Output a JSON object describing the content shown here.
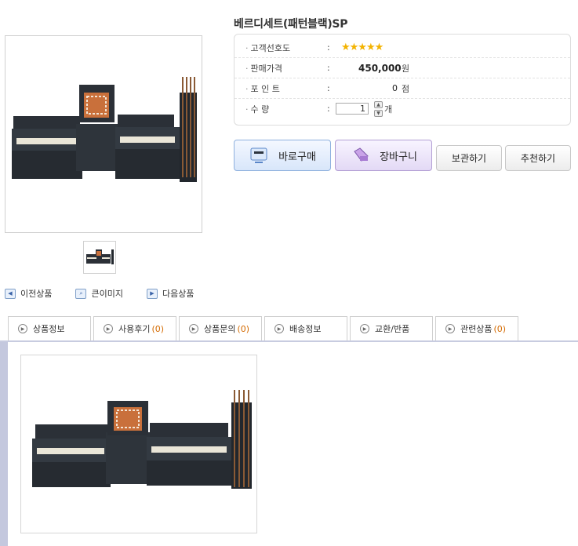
{
  "product": {
    "title": "베르디세트(패턴블랙)SP",
    "rating_label": "고객선호도",
    "rating_stars": 5,
    "rating_display": "★★★★★",
    "price_label": "판매가격",
    "price_value": "450,000",
    "price_unit": "원",
    "point_label": "포 인 트",
    "point_value": "0",
    "point_unit": "점",
    "qty_label": "수 량",
    "qty_value": "1",
    "qty_unit": "개",
    "colon": ":"
  },
  "buttons": {
    "buy": "바로구매",
    "cart": "장바구니",
    "keep": "보관하기",
    "recommend": "추천하기"
  },
  "nav": {
    "prev": "이전상품",
    "zoom": "큰이미지",
    "next": "다음상품"
  },
  "tabs": [
    {
      "label": "상품정보",
      "count": ""
    },
    {
      "label": "사용후기",
      "count": "(0)"
    },
    {
      "label": "상품문의",
      "count": "(0)"
    },
    {
      "label": "배송정보",
      "count": ""
    },
    {
      "label": "교환/반품",
      "count": ""
    },
    {
      "label": "관련상품",
      "count": "(0)"
    }
  ],
  "colors": {
    "star": "#f3b300",
    "count": "#d46a00",
    "tab_line": "#c8cce0"
  }
}
